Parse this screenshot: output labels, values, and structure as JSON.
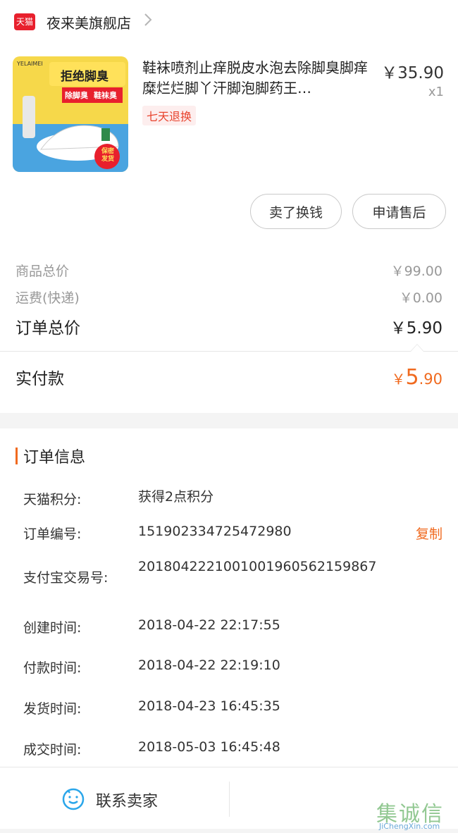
{
  "store": {
    "badge": "天猫",
    "name": "夜来美旗舰店"
  },
  "product": {
    "image": {
      "brand": "YELAIMEI",
      "headline": "拒绝脚臭",
      "sub1": "除脚臭",
      "sub2": "鞋袜臭",
      "stamp": "保密发货"
    },
    "title": "鞋袜喷剂止痒脱皮水泡去除脚臭脚痒糜烂烂脚丫汗脚泡脚药王…",
    "price": "￥35.90",
    "qty": "x1",
    "tag": "七天退换"
  },
  "actions": {
    "sell": "卖了换钱",
    "after_sale": "申请售后"
  },
  "summary": {
    "goods_total_label": "商品总价",
    "goods_total_value": "￥99.00",
    "shipping_label": "运费(快递)",
    "shipping_value": "￥0.00",
    "order_total_label": "订单总价",
    "order_total_value": "￥5.90",
    "paid_label": "实付款",
    "paid_currency": "￥",
    "paid_int": "5",
    "paid_dec": ".90"
  },
  "order_info": {
    "section_title": "订单信息",
    "rows": [
      {
        "label": "天猫积分:",
        "value": "获得2点积分"
      },
      {
        "label": "订单编号:",
        "value": "151902334725472980"
      },
      {
        "label": "支付宝交易号:",
        "value": "2018042221001001960562159867"
      },
      {
        "label": "创建时间:",
        "value": "2018-04-22 22:17:55"
      },
      {
        "label": "付款时间:",
        "value": "2018-04-22 22:19:10"
      },
      {
        "label": "发货时间:",
        "value": "2018-04-23 16:45:35"
      },
      {
        "label": "成交时间:",
        "value": "2018-05-03 16:45:48"
      }
    ],
    "copy_label": "复制"
  },
  "bottom": {
    "contact_label": "联系卖家"
  },
  "watermark": {
    "chars": "集诚信",
    "url": "JiChengXin.com"
  },
  "colors": {
    "accent": "#f06a1f",
    "tmall_red": "#e8202d"
  },
  "icons": {
    "store_chevron": "chevron-right-icon",
    "contact": "chat-bubble-icon"
  }
}
